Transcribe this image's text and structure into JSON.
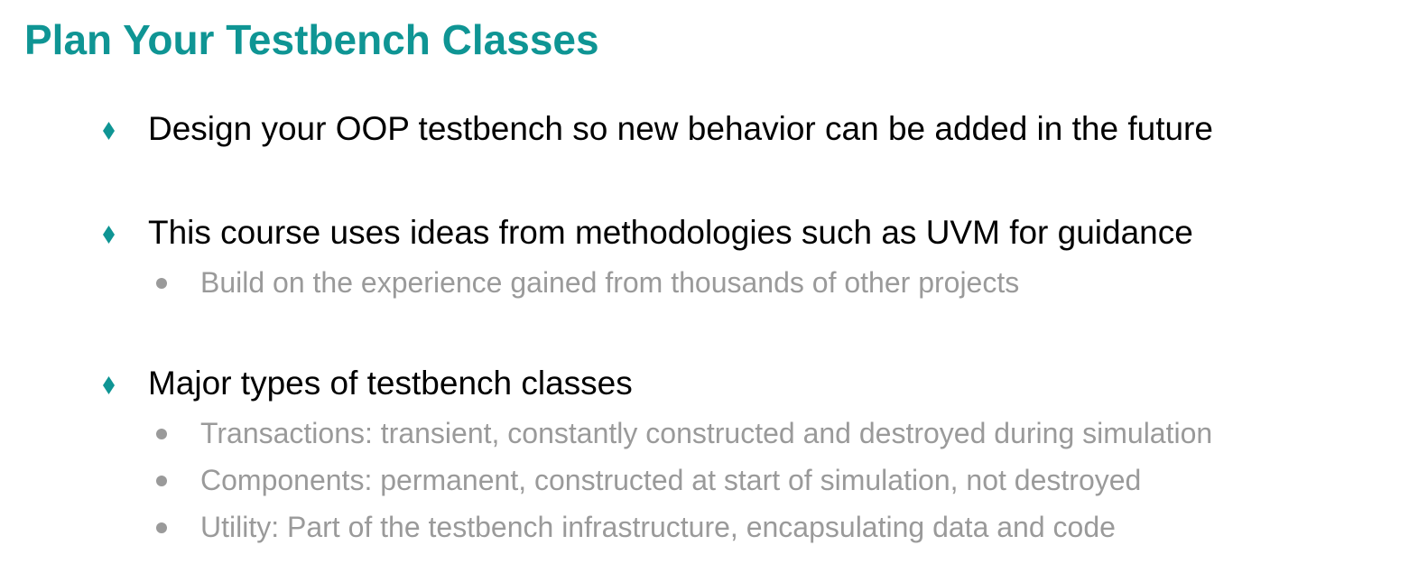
{
  "title": "Plan Your Testbench Classes",
  "colors": {
    "accent": "#0f9594",
    "body_text": "#000000",
    "sub_text": "#9a9a9a"
  },
  "bullets": [
    {
      "icon": "diamond-bullet-icon",
      "text": "Design your OOP testbench so new behavior can be added in the future",
      "subitems": []
    },
    {
      "icon": "diamond-bullet-icon",
      "text": "This course uses ideas from methodologies such as UVM for guidance",
      "subitems": [
        {
          "icon": "dot-bullet-icon",
          "text": "Build on the experience gained from thousands of other projects"
        }
      ]
    },
    {
      "icon": "diamond-bullet-icon",
      "text": "Major types of testbench classes",
      "subitems": [
        {
          "icon": "dot-bullet-icon",
          "text": "Transactions: transient, constantly constructed and destroyed during simulation"
        },
        {
          "icon": "dot-bullet-icon",
          "text": "Components: permanent, constructed at start of simulation, not destroyed"
        },
        {
          "icon": "dot-bullet-icon",
          "text": "Utility: Part of the testbench infrastructure, encapsulating data and code"
        }
      ]
    }
  ]
}
